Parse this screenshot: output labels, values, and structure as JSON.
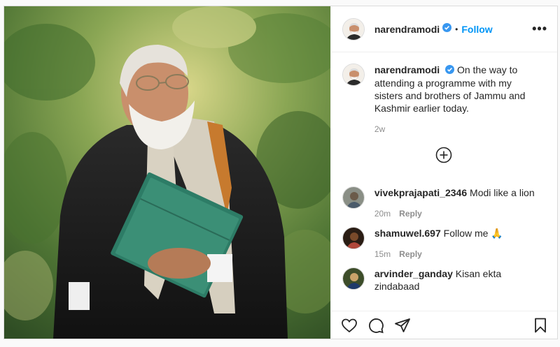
{
  "post": {
    "author": "narendramodi",
    "verified": true,
    "dot": "•",
    "follow_label": "Follow",
    "more_label": "•••",
    "caption": "On the way to attending a programme with my sisters and brothers of Jammu and Kashmir earlier today.",
    "time": "2w"
  },
  "load_more_icon": "plus-circle-icon",
  "comments": [
    {
      "user": "vivekprajapati_2346",
      "text": "Modi like a lion",
      "time": "20m",
      "reply": "Reply"
    },
    {
      "user": "shamuwel.697",
      "text": "Follow me 🙏",
      "time": "15m",
      "reply": "Reply"
    },
    {
      "user": "arvinder_ganday",
      "text": "Kisan ekta zindabaad",
      "time": "",
      "reply": ""
    }
  ],
  "actions": {
    "like": "heart-icon",
    "comment": "comment-icon",
    "share": "paper-plane-icon",
    "save": "bookmark-icon"
  },
  "colors": {
    "link": "#0095f6",
    "verified": "#3897f0",
    "muted": "#8e8e8e",
    "text": "#262626"
  }
}
